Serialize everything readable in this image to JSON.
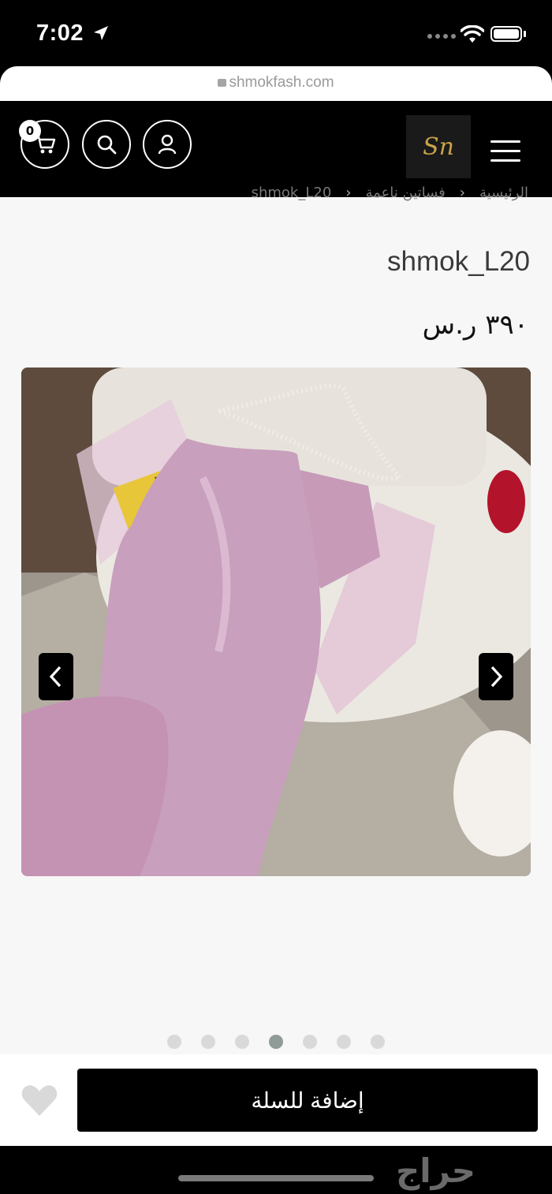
{
  "status_bar": {
    "time": "7:02"
  },
  "browser": {
    "url": "shmokfash.com"
  },
  "header": {
    "cart_count": "0",
    "logo_text": "Sn"
  },
  "breadcrumb": [
    "الرئيسية",
    "فساتين ناعمة",
    "shmok_L20"
  ],
  "product": {
    "title": "shmok_L20",
    "price": "٣٩٠ ر.س"
  },
  "gallery": {
    "slide_count": 7,
    "active_index": 3
  },
  "actions": {
    "add_to_cart": "إضافة للسلة"
  },
  "watermark": "حراج",
  "colors": {
    "dress": "#c9a3bd",
    "header_bg": "#000000",
    "logo_gold": "#c9a24a"
  }
}
